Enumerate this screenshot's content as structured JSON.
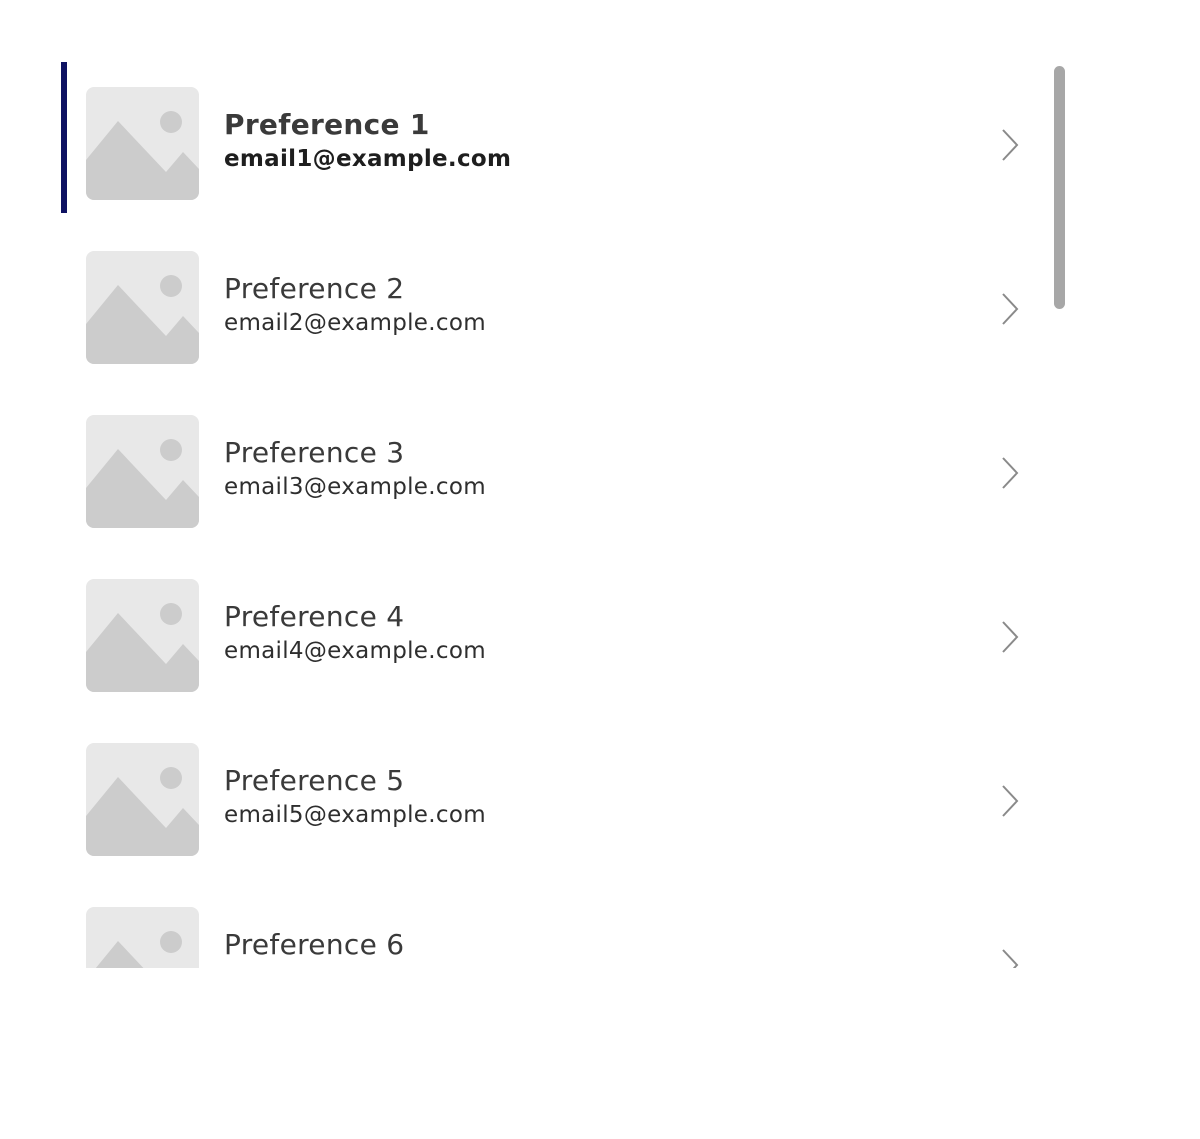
{
  "gallery": {
    "selected_index": 0,
    "items": [
      {
        "title": "Preference 1",
        "subtitle": "email1@example.com"
      },
      {
        "title": "Preference 2",
        "subtitle": "email2@example.com"
      },
      {
        "title": "Preference 3",
        "subtitle": "email3@example.com"
      },
      {
        "title": "Preference 4",
        "subtitle": "email4@example.com"
      },
      {
        "title": "Preference 5",
        "subtitle": "email5@example.com"
      },
      {
        "title": "Preference 6",
        "subtitle": ""
      }
    ],
    "thumbnail_icon": "image-placeholder-icon",
    "nav_icon": "chevron-right-icon"
  },
  "colors": {
    "selection_bar": "#0e1262",
    "placeholder_bg": "#e8e8e8",
    "placeholder_shape": "#cccccc",
    "chevron": "#8a8a8a",
    "scrollbar": "#a7a7a7"
  }
}
